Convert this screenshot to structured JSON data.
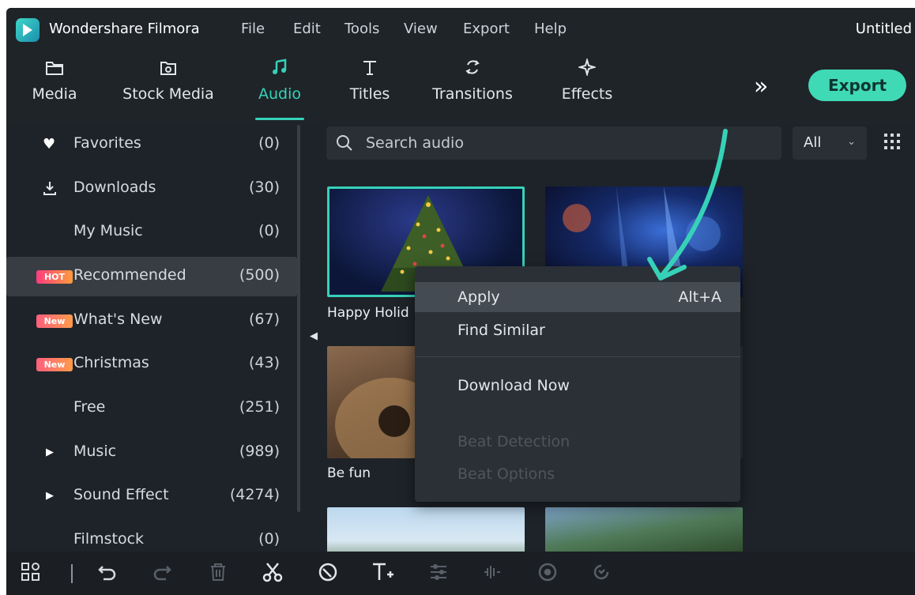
{
  "titlebar": {
    "app_name": "Wondershare Filmora",
    "menu": [
      "File",
      "Edit",
      "Tools",
      "View",
      "Export",
      "Help"
    ],
    "document_title": "Untitled"
  },
  "toolbar": {
    "tabs": [
      {
        "label": "Media",
        "icon": "folder-icon"
      },
      {
        "label": "Stock Media",
        "icon": "stock-media-icon"
      },
      {
        "label": "Audio",
        "icon": "music-note-icon",
        "active": true
      },
      {
        "label": "Titles",
        "icon": "text-t-icon"
      },
      {
        "label": "Transitions",
        "icon": "transitions-icon"
      },
      {
        "label": "Effects",
        "icon": "effects-sparkle-icon"
      }
    ],
    "more_label": "»",
    "export_label": "Export"
  },
  "sidebar": {
    "items": [
      {
        "label": "Favorites",
        "count": "(0)",
        "icon": "heart-icon"
      },
      {
        "label": "Downloads",
        "count": "(30)",
        "icon": "download-icon"
      },
      {
        "label": "My Music",
        "count": "(0)"
      },
      {
        "label": "Recommended",
        "count": "(500)",
        "badge": "HOT",
        "selected": true
      },
      {
        "label": "What's New",
        "count": "(67)",
        "badge": "New"
      },
      {
        "label": "Christmas",
        "count": "(43)",
        "badge": "New"
      },
      {
        "label": "Free",
        "count": "(251)"
      },
      {
        "label": "Music",
        "count": "(989)",
        "expandable": true
      },
      {
        "label": "Sound Effect",
        "count": "(4274)",
        "expandable": true
      },
      {
        "label": "Filmstock",
        "count": "(0)"
      }
    ]
  },
  "search": {
    "placeholder": "Search audio",
    "filter_value": "All"
  },
  "thumbnails": [
    {
      "label": "Happy Holid",
      "selected": true
    },
    {
      "label": ""
    },
    {
      "label": "Be fun"
    },
    {
      "label": ""
    },
    {
      "label": ""
    },
    {
      "label": ""
    }
  ],
  "context_menu": {
    "items": [
      {
        "label": "Apply",
        "shortcut": "Alt+A",
        "highlighted": true
      },
      {
        "label": "Find Similar"
      },
      {
        "label": "Download Now"
      },
      {
        "label": "Beat Detection",
        "disabled": true
      },
      {
        "label": "Beat Options",
        "disabled": true
      }
    ]
  },
  "colors": {
    "accent": "#36d2b8",
    "export_button": "#40d9b6",
    "background": "#1e2329",
    "menu_background": "#2b3037"
  },
  "bottombar": {
    "icons": [
      "layout-icon",
      "undo-icon",
      "redo-icon",
      "delete-icon",
      "cut-icon",
      "tag-icon",
      "add-text-icon",
      "adjust-icon",
      "split-audio-icon",
      "color-icon",
      "speed-icon"
    ]
  }
}
